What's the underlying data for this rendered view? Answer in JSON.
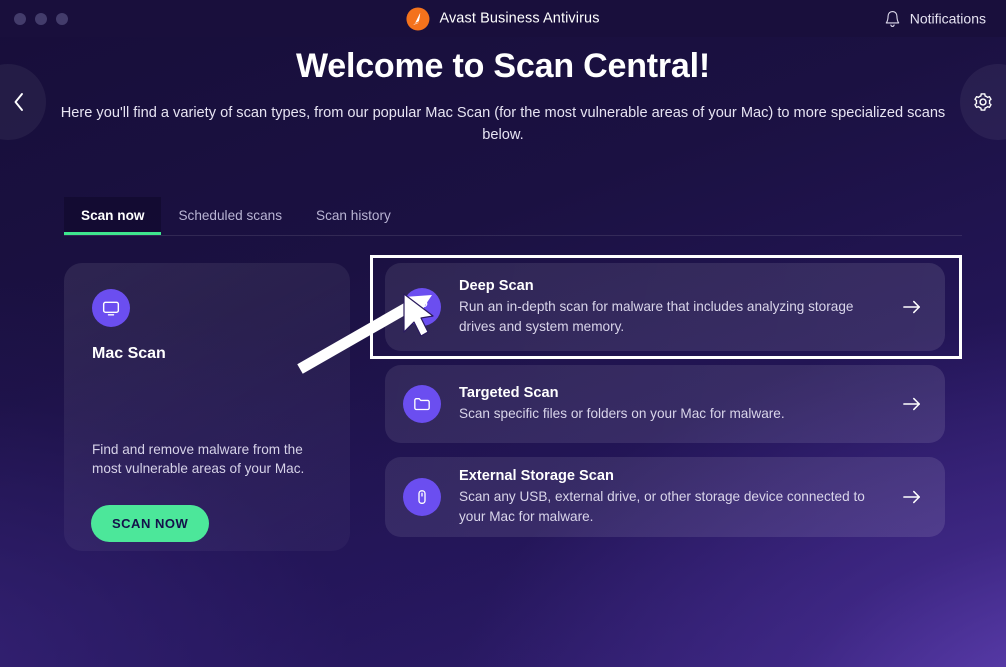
{
  "window": {
    "traffic_lights": [
      "close",
      "minimize",
      "zoom"
    ],
    "brand_title": "Avast Business Antivirus",
    "notifications_label": "Notifications",
    "brand_color": "#f4721c"
  },
  "nav": {
    "back_label": "Back",
    "settings_label": "Settings"
  },
  "hero": {
    "title": "Welcome to Scan Central!",
    "subtitle": "Here you'll find a variety of scan types, from our popular Mac Scan (for the most vulnerable areas of your Mac) to more specialized scans below."
  },
  "tabs": {
    "active_index": 0,
    "items": [
      {
        "label": "Scan now"
      },
      {
        "label": "Scheduled scans"
      },
      {
        "label": "Scan history"
      }
    ],
    "active_underline_color": "#3ee78e"
  },
  "mac_card": {
    "icon": "monitor-icon",
    "title": "Mac Scan",
    "description": "Find and remove malware from the most vulnerable areas of your Mac.",
    "button_label": "SCAN NOW",
    "button_color": "#4ce79a",
    "icon_bg": "#6b4ef0"
  },
  "scan_rows": [
    {
      "icon": "magnifier-molecule-icon",
      "title": "Deep Scan",
      "description": "Run an in-depth scan for malware that includes analyzing storage drives and system memory.",
      "arrow": "arrow-right-icon",
      "highlighted": true
    },
    {
      "icon": "folder-icon",
      "title": "Targeted Scan",
      "description": "Scan specific files or folders on your Mac for malware.",
      "arrow": "arrow-right-icon",
      "highlighted": false
    },
    {
      "icon": "usb-drive-icon",
      "title": "External Storage Scan",
      "description": "Scan any USB, external drive, or other storage device connected to your Mac for malware.",
      "arrow": "arrow-right-icon",
      "highlighted": false
    }
  ],
  "annotation": {
    "highlight_color": "#ffffff",
    "pointer": "annotation-arrow",
    "cursor": "mouse-pointer"
  }
}
